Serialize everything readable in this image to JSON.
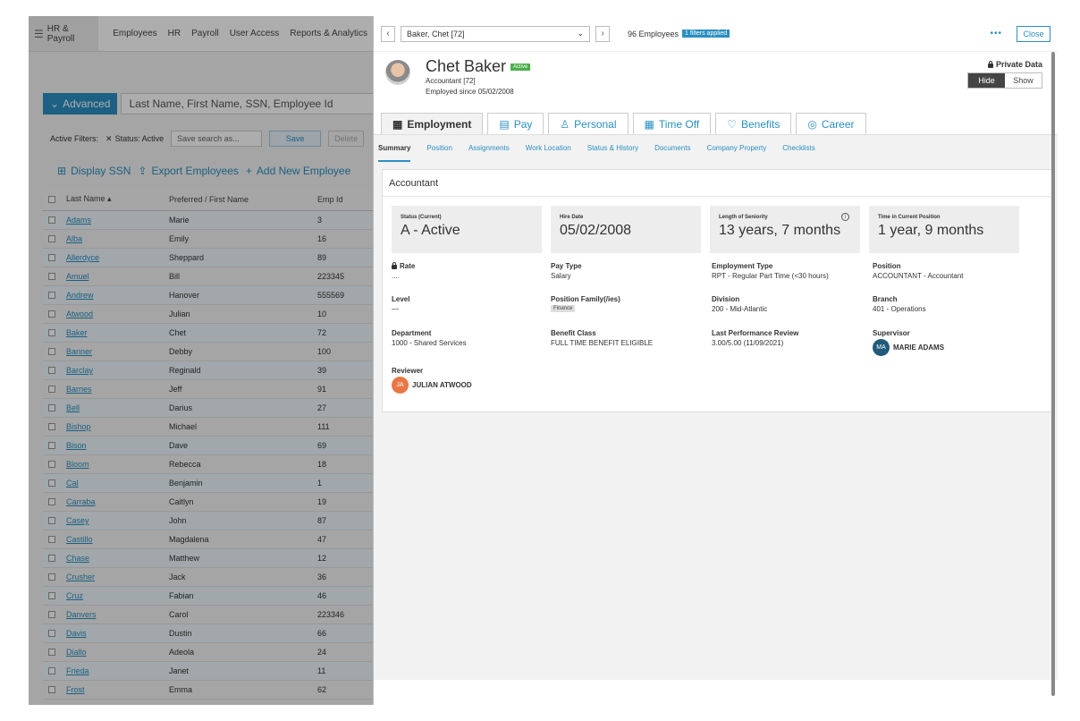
{
  "topnav": {
    "brand": "HR & Payroll",
    "items": [
      "Employees",
      "HR",
      "Payroll",
      "User Access",
      "Reports & Analytics"
    ]
  },
  "search": {
    "advanced_label": "Advanced",
    "placeholder": "Last Name, First Name, SSN, Employee Id"
  },
  "filters": {
    "label": "Active Filters:",
    "chip": "Status: Active",
    "save_placeholder": "Save search as...",
    "save_label": "Save",
    "delete_label": "Delete"
  },
  "actions": {
    "display_ssn": "Display SSN",
    "export": "Export Employees",
    "add": "Add New Employee"
  },
  "grid": {
    "headers": {
      "last": "Last Name ▴",
      "first": "Preferred / First Name",
      "id": "Emp Id"
    },
    "rows": [
      {
        "last": "Adams",
        "first": "Marie",
        "id": "3"
      },
      {
        "last": "Alba",
        "first": "Emily",
        "id": "16"
      },
      {
        "last": "Allerdyce",
        "first": "Sheppard",
        "id": "89"
      },
      {
        "last": "Amuel",
        "first": "Bill",
        "id": "223345"
      },
      {
        "last": "Andrew",
        "first": "Hanover",
        "id": "555569"
      },
      {
        "last": "Atwood",
        "first": "Julian",
        "id": "10"
      },
      {
        "last": "Baker",
        "first": "Chet",
        "id": "72"
      },
      {
        "last": "Banner",
        "first": "Debby",
        "id": "100"
      },
      {
        "last": "Barclay",
        "first": "Reginald",
        "id": "39"
      },
      {
        "last": "Barnes",
        "first": "Jeff",
        "id": "91"
      },
      {
        "last": "Bell",
        "first": "Darius",
        "id": "27"
      },
      {
        "last": "Bishop",
        "first": "Michael",
        "id": "111"
      },
      {
        "last": "Bison",
        "first": "Dave",
        "id": "69"
      },
      {
        "last": "Bloom",
        "first": "Rebecca",
        "id": "18"
      },
      {
        "last": "Cal",
        "first": "Benjamin",
        "id": "1"
      },
      {
        "last": "Carraba",
        "first": "Caitlyn",
        "id": "19"
      },
      {
        "last": "Casey",
        "first": "John",
        "id": "87"
      },
      {
        "last": "Castillo",
        "first": "Magdalena",
        "id": "47"
      },
      {
        "last": "Chase",
        "first": "Matthew",
        "id": "12"
      },
      {
        "last": "Crusher",
        "first": "Jack",
        "id": "36"
      },
      {
        "last": "Cruz",
        "first": "Fabian",
        "id": "46"
      },
      {
        "last": "Danvers",
        "first": "Carol",
        "id": "223346"
      },
      {
        "last": "Davis",
        "first": "Dustin",
        "id": "66"
      },
      {
        "last": "Diallo",
        "first": "Adeola",
        "id": "24"
      },
      {
        "last": "Frieda",
        "first": "Janet",
        "id": "11"
      },
      {
        "last": "Frost",
        "first": "Emma",
        "id": "62"
      }
    ]
  },
  "panel": {
    "selector_value": "Baker, Chet [72]",
    "count": "96 Employees",
    "filters_badge": "1 filters applied",
    "more": "•••",
    "close": "Close",
    "name": "Chet Baker",
    "status_badge": "Active",
    "title_line": "Accountant [72]",
    "since_line": "Employed since 05/02/2008",
    "private_label": "Private Data",
    "hide": "Hide",
    "show": "Show",
    "tabs": [
      "Employment",
      "Pay",
      "Personal",
      "Time Off",
      "Benefits",
      "Career"
    ],
    "subnav": [
      "Summary",
      "Position",
      "Assignments",
      "Work Location",
      "Status & History",
      "Documents",
      "Company Property",
      "Checklists"
    ],
    "card_title": "Accountant",
    "stats": [
      {
        "k": "Status (Current)",
        "v": "A - Active"
      },
      {
        "k": "Hire Date",
        "v": "05/02/2008"
      },
      {
        "k": "Length of Seniority",
        "v": "13 years, 7 months"
      },
      {
        "k": "Time in Current Position",
        "v": "1 year, 9 months"
      }
    ],
    "fields": {
      "rate": {
        "k": "Rate",
        "v": "...."
      },
      "pay_type": {
        "k": "Pay Type",
        "v": "Salary"
      },
      "emp_type": {
        "k": "Employment Type",
        "v": "RPT - Regular Part Time (<30 hours)"
      },
      "position": {
        "k": "Position",
        "v": "ACCOUNTANT - Accountant"
      },
      "level": {
        "k": "Level",
        "v": "—"
      },
      "pos_family": {
        "k": "Position Family(/ies)",
        "v": "Finance"
      },
      "division": {
        "k": "Division",
        "v": "200 - Mid-Atlantic"
      },
      "branch": {
        "k": "Branch",
        "v": "401 - Operations"
      },
      "department": {
        "k": "Department",
        "v": "1000 - Shared Services"
      },
      "benefit_class": {
        "k": "Benefit Class",
        "v": "FULL TIME BENEFIT ELIGIBLE"
      },
      "last_review": {
        "k": "Last Performance Review",
        "v": "3.00/5.00 (11/09/2021)"
      },
      "supervisor": {
        "k": "Supervisor",
        "initials": "MA",
        "v": "MARIE ADAMS"
      },
      "reviewer": {
        "k": "Reviewer",
        "initials": "JA",
        "v": "JULIAN ATWOOD"
      }
    }
  }
}
